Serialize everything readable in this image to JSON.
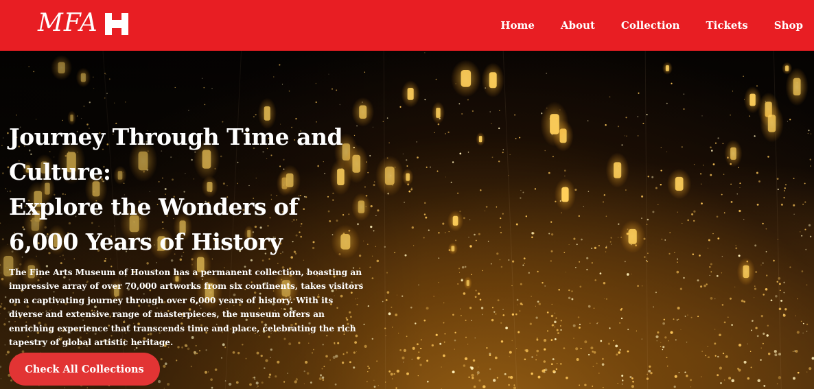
{
  "header": {
    "logo_text": "MFA",
    "logo_mark_icon": "mfah-h-icon",
    "nav": [
      "Home",
      "About",
      "Collection",
      "Tickets",
      "Shop"
    ]
  },
  "hero": {
    "title_line1": "Journey Through Time and Culture:",
    "title_line2": "Explore the Wonders of 6,000 Years of History",
    "description": "The Fine Arts Museum of Houston has a permanent collection, boasting an impressive array of over 70,000 artworks from six continents, takes visitors on a captivating journey through over 6,000 years of history. With its diverse and extensive range of masterpieces, the museum offers an enriching experience that transcends time and place, celebrating the rich tapestry of global artistic heritage.",
    "cta_label": "Check All Collections",
    "background_image": "infinity-room-lanterns-image"
  },
  "colors": {
    "brand_red": "#e81e23",
    "button_red": "#e23434",
    "text_white": "#ffffff"
  }
}
